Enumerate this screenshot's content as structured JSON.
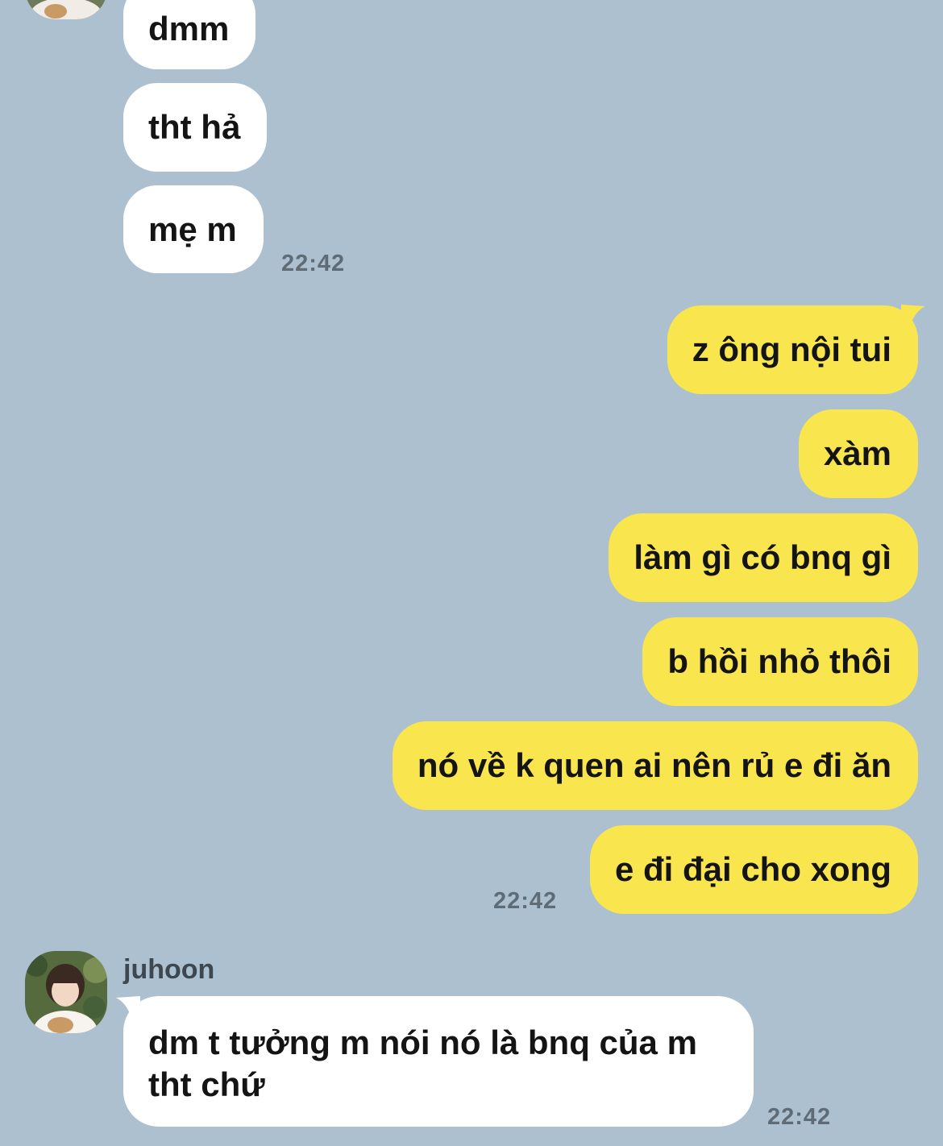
{
  "chat": {
    "top_incoming": [
      {
        "text": "dmm"
      },
      {
        "text": "tht hả"
      },
      {
        "text": "mẹ m"
      }
    ],
    "top_incoming_time": "22:42",
    "outgoing": [
      {
        "text": "z ông nội tui"
      },
      {
        "text": "xàm"
      },
      {
        "text": "làm gì có bnq gì"
      },
      {
        "text": "b hồi nhỏ thôi"
      },
      {
        "text": "nó về k quen ai nên rủ e đi ăn"
      },
      {
        "text": "e đi đại cho xong"
      }
    ],
    "outgoing_time": "22:42",
    "last_sender": {
      "name": "juhoon",
      "message": "dm t tưởng m nói nó là bnq của m tht chứ",
      "time": "22:42"
    }
  },
  "colors": {
    "background": "#adc0d0",
    "incoming_bubble": "#ffffff",
    "outgoing_bubble": "#f9e54e",
    "timestamp": "#5f6b75"
  }
}
